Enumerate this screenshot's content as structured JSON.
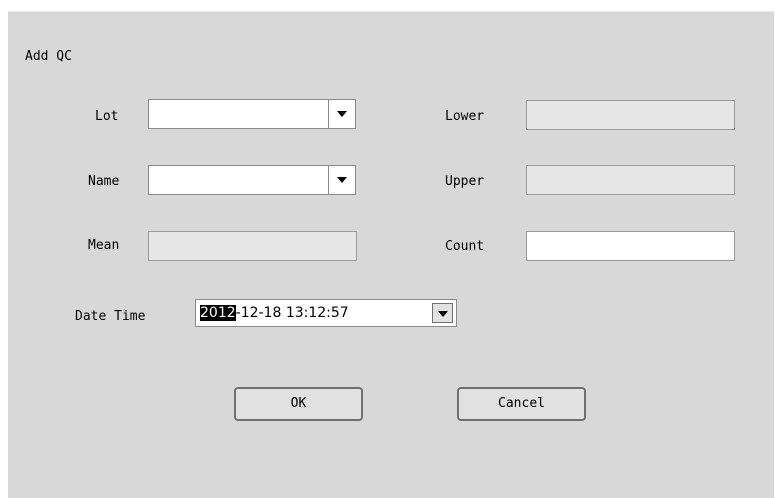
{
  "dialog": {
    "title": "Add QC"
  },
  "form": {
    "lot_label": "Lot",
    "name_label": "Name",
    "mean_label": "Mean",
    "lower_label": "Lower",
    "upper_label": "Upper",
    "count_label": "Count",
    "datetime_label": "Date Time",
    "lot_value": "",
    "name_value": "",
    "mean_value": "",
    "lower_value": "",
    "upper_value": "",
    "count_value": "",
    "datetime_year_selected": "2012",
    "datetime_rest": "-12-18 13:12:57"
  },
  "buttons": {
    "ok_label": "OK",
    "cancel_label": "Cancel"
  },
  "icons": {
    "dropdown": "chevron-down-icon"
  }
}
